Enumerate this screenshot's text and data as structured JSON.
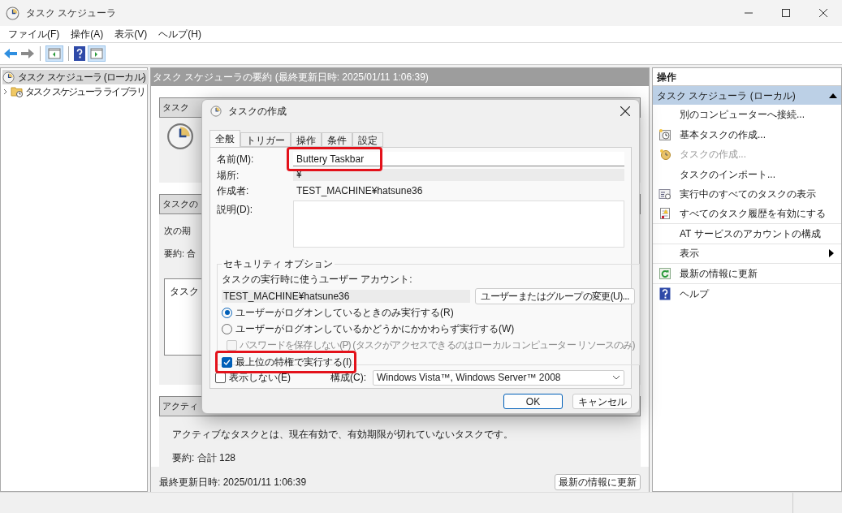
{
  "window": {
    "title": "タスク スケジューラ"
  },
  "menu": [
    "ファイル(F)",
    "操作(A)",
    "表示(V)",
    "ヘルプ(H)"
  ],
  "tree": [
    {
      "label": "タスク スケジューラ (ローカル)",
      "selected": true,
      "children": [
        {
          "label": "タスク スケジューラ ライブラリ",
          "selected": false,
          "expanded": false
        }
      ]
    }
  ],
  "summary": {
    "header": "タスク スケジューラの要約 (最終更新日時: 2025/01/11 1:06:39)",
    "section_1": {
      "title": "タスク"
    },
    "section_2": {
      "title": "タスクの",
      "lines": [
        "次の期",
        "要約: 合"
      ],
      "inner_title": "タスク"
    },
    "section_3": {
      "title": "アクティ",
      "lines": [
        "アクティブなタスクとは、現在有効で、有効期限が切れていないタスクです。",
        "要約: 合計 128"
      ]
    },
    "last_updated": "最終更新日時: 2025/01/11 1:06:39",
    "refresh_button": "最新の情報に更新"
  },
  "actions": {
    "title": "操作",
    "group": {
      "label": "タスク スケジューラ (ローカル)",
      "expanded": true
    },
    "items": [
      {
        "label": "別のコンピューターへ接続...",
        "kind": "text",
        "disabled": false
      },
      {
        "label": "基本タスクの作成...",
        "kind": "calendar",
        "disabled": false
      },
      {
        "label": "タスクの作成...",
        "kind": "task",
        "disabled": true
      },
      {
        "label": "タスクのインポート...",
        "kind": "text",
        "disabled": false
      },
      {
        "label": "実行中のすべてのタスクの表示",
        "kind": "list",
        "disabled": false
      },
      {
        "label": "すべてのタスク履歴を有効にする",
        "kind": "log",
        "disabled": false
      },
      {
        "label": "AT サービスのアカウントの構成",
        "kind": "text",
        "disabled": false
      },
      {
        "label": "表示",
        "kind": "submenu",
        "disabled": false
      },
      {
        "label": "最新の情報に更新",
        "kind": "refresh",
        "disabled": false
      },
      {
        "label": "ヘルプ",
        "kind": "help",
        "disabled": false
      }
    ]
  },
  "dialog": {
    "title": "タスクの作成",
    "tabs": [
      {
        "label": "全般",
        "selected": true
      },
      {
        "label": "トリガー",
        "selected": false
      },
      {
        "label": "操作",
        "selected": false
      },
      {
        "label": "条件",
        "selected": false
      },
      {
        "label": "設定",
        "selected": false
      }
    ],
    "name": {
      "label": "名前(M):",
      "value": "Buttery Taskbar",
      "highlighted": true
    },
    "location": {
      "label": "場所:",
      "value": "¥"
    },
    "author": {
      "label": "作成者:",
      "value": "TEST_MACHINE¥hatsune36"
    },
    "description": {
      "label": "説明(D):"
    },
    "security": {
      "legend": "セキュリティ オプション",
      "account_label": "タスクの実行時に使うユーザー アカウント:",
      "account": "TEST_MACHINE¥hatsune36",
      "change_button": "ユーザーまたはグループの変更(U)...",
      "radios": [
        {
          "label": "ユーザーがログオンしているときのみ実行する(R)",
          "selected": true
        },
        {
          "label": "ユーザーがログオンしているかどうかにかかわらず実行する(W)",
          "selected": false
        }
      ],
      "no_password": {
        "label": "パスワードを保存しない(P) (タスクがアクセスできるのはローカル コンピューター リソースのみ)",
        "checked": false,
        "disabled": true
      },
      "highest": {
        "label": "最上位の特権で実行する(I)",
        "checked": true,
        "highlighted": true
      }
    },
    "hidden": {
      "label": "表示しない(E)",
      "checked": false
    },
    "configure": {
      "label": "構成(C):",
      "value": "Windows Vista™, Windows Server™ 2008"
    },
    "ok": "OK",
    "cancel": "キャンセル"
  }
}
